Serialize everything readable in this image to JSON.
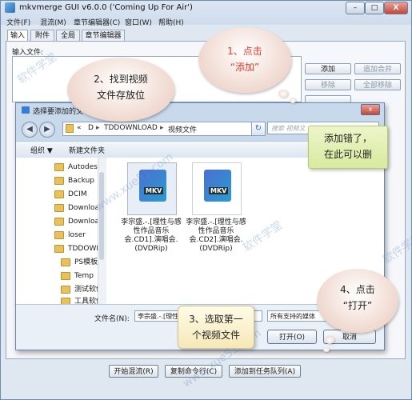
{
  "window": {
    "title": "mkvmerge GUI v6.0.0 ('Coming Up For Air')",
    "minimize": "–",
    "maximize": "□",
    "close": "X"
  },
  "menu": [
    "文件(F)",
    "混流(M)",
    "章节编辑器(C)",
    "窗口(W)",
    "帮助(H)"
  ],
  "tabs": [
    "输入",
    "附件",
    "全局",
    "章节编辑器"
  ],
  "input": {
    "label": "输入文件:",
    "buttons": [
      "添加",
      "追加合并",
      "移除",
      "全部移除"
    ]
  },
  "bottom_buttons": [
    "开始混流(R)",
    "复制命令行(C)",
    "添加到任务队列(A)"
  ],
  "dialog": {
    "title": "选择要添加的文",
    "close": "x",
    "back": "◀",
    "forward": "▶",
    "path": [
      "«",
      "D",
      "TDDOWNLOAD",
      "视频文件"
    ],
    "search_placeholder": "搜索 视频文",
    "refresh": "↻",
    "organize": "组织 ▼",
    "new_folder": "新建文件夹",
    "folders": [
      "Autodesk",
      "Backup",
      "DCIM",
      "Download",
      "Download",
      "loser",
      "TDDOWNL",
      "PS模板",
      "Temp",
      "测试软件",
      "工具软件"
    ],
    "files": [
      {
        "name": "李宗盛.-.[理性与感性作品音乐会.CD1].演唱会.(DVDRip)",
        "icon": "MKV"
      },
      {
        "name": "李宗盛.-.[理性与感性作品音乐会.CD2].演唱会.(DVDRip)",
        "icon": "MKV"
      }
    ],
    "filename_label": "文件名(N):",
    "filename_value": "李宗盛.-.[理性与",
    "filetype_value": "所有支持的媒体",
    "open": "打开(O)",
    "cancel": "取消"
  },
  "annotations": {
    "step1": [
      "1、点击",
      "“添加”"
    ],
    "step2": [
      "2、找到视频",
      "文件存放位"
    ],
    "delete_tip": [
      "添加错了，",
      "在此可以删"
    ],
    "step3": [
      "3、选取第一",
      "个视频文件"
    ],
    "step4": [
      "4、点击",
      "“打开”"
    ]
  },
  "watermark": [
    "软件学堂",
    "www.xue51.com"
  ]
}
